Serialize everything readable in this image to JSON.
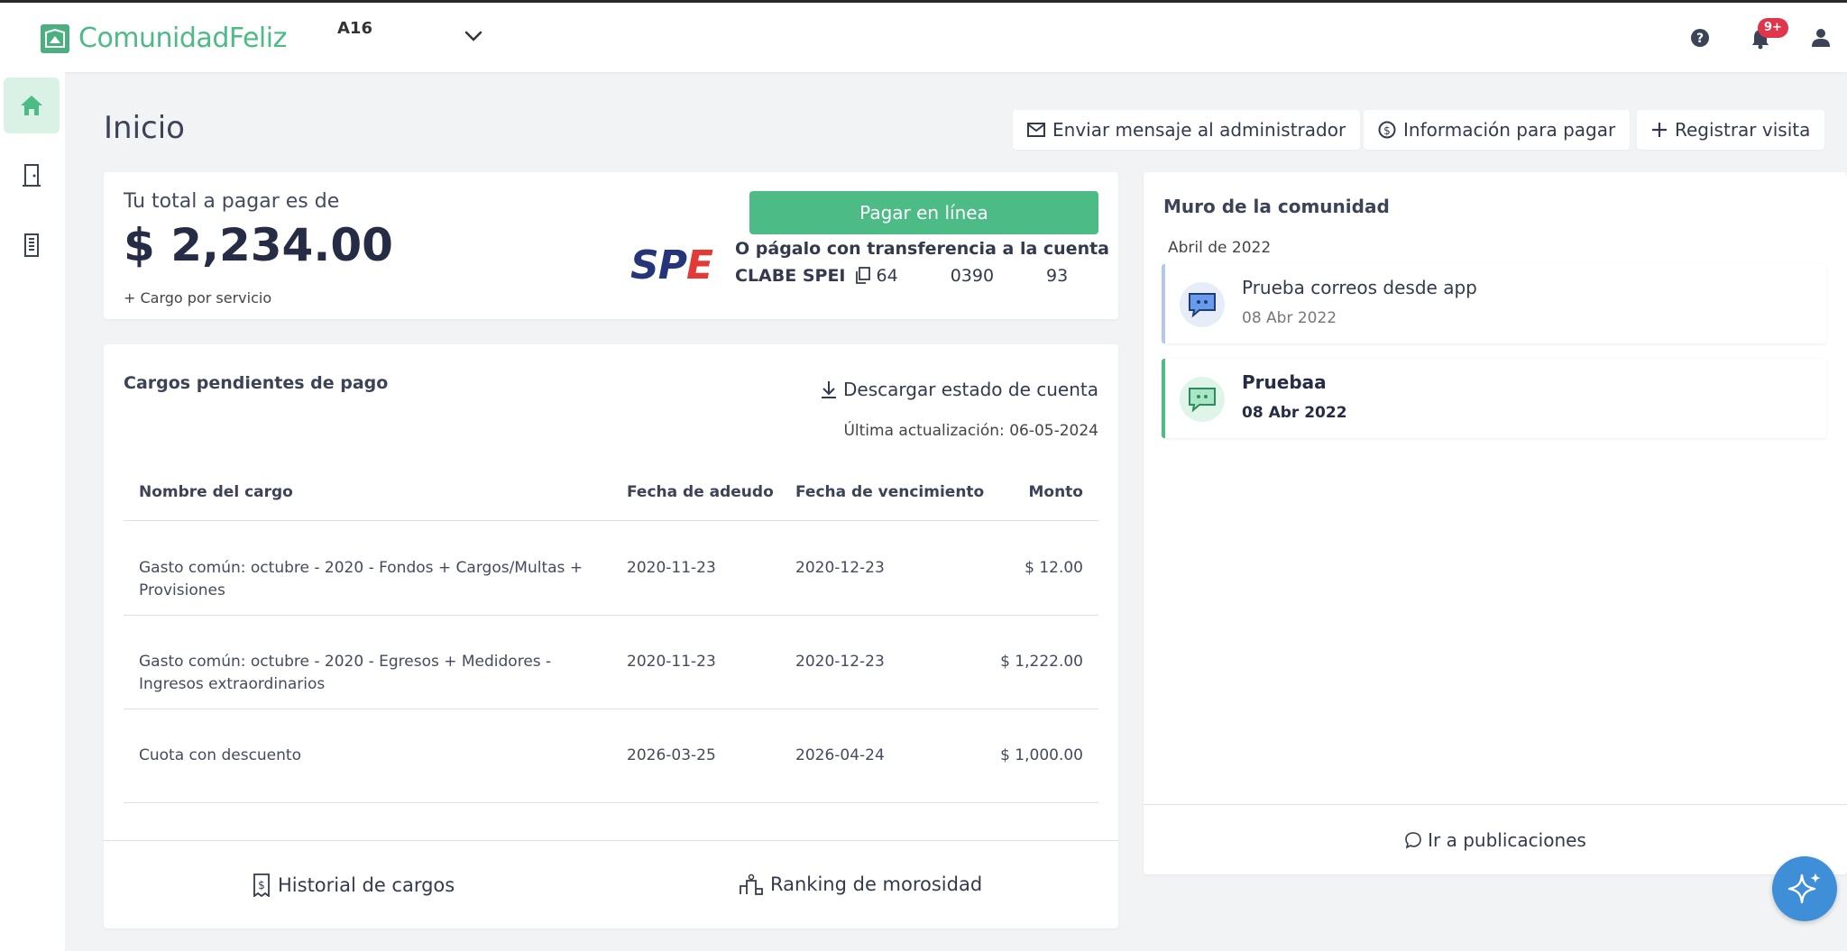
{
  "app": {
    "brand": "ComunidadFeliz",
    "unit_selector": "A16",
    "notifications_badge": "9+"
  },
  "page": {
    "title": "Inicio"
  },
  "actions": {
    "message_admin": "Enviar mensaje al administrador",
    "payment_info": "Información para pagar",
    "register_visit": "Registrar visita"
  },
  "payment": {
    "label": "Tu total a pagar es de",
    "amount": "$ 2,234.00",
    "service_charge": "+ Cargo por servicio",
    "pay_online": "Pagar en línea",
    "transfer_text": "O págalo con transferencia a la cuenta",
    "clabe_label": "CLABE SPEI",
    "clabe_parts": [
      "64",
      "0390",
      "93"
    ],
    "spei_logo": {
      "main": "SP",
      "accent": "E"
    }
  },
  "charges": {
    "title": "Cargos pendientes de pago",
    "download": "Descargar estado de cuenta",
    "last_update": "Última actualización: 06-05-2024",
    "columns": [
      "Nombre del cargo",
      "Fecha de adeudo",
      "Fecha de vencimiento",
      "Monto"
    ],
    "rows": [
      {
        "name": "Gasto común: octubre - 2020 - Fondos + Cargos/Multas + Provisiones",
        "debt_date": "2020-11-23",
        "due_date": "2020-12-23",
        "amount": "$ 12.00"
      },
      {
        "name": "Gasto común: octubre - 2020 - Egresos + Medidores - Ingresos extraordinarios",
        "debt_date": "2020-11-23",
        "due_date": "2020-12-23",
        "amount": "$ 1,222.00"
      },
      {
        "name": "Cuota con descuento",
        "debt_date": "2026-03-25",
        "due_date": "2026-04-24",
        "amount": "$ 1,000.00"
      }
    ],
    "history_link": "Historial de cargos",
    "ranking_link": "Ranking de morosidad"
  },
  "wall": {
    "title": "Muro de la comunidad",
    "month": "Abril de 2022",
    "posts": [
      {
        "title": "Prueba correos desde app",
        "date": "08 Abr 2022"
      },
      {
        "title": "Pruebaa",
        "date": "08 Abr 2022"
      }
    ],
    "go_to_posts": "Ir a publicaciones"
  },
  "colors": {
    "brand": "#4cbb86",
    "active_nav": "#d9f2e5",
    "badge": "#e0364b",
    "post_read": "#b9c7e6",
    "post_unread": "#4cbb86",
    "fab": "#3e8fd8"
  },
  "icons": [
    "home-icon",
    "door-icon",
    "building-icon",
    "help-icon",
    "bell-icon",
    "user-icon",
    "mail-icon",
    "dollar-circle-icon",
    "plus-icon",
    "download-icon",
    "copy-icon",
    "receipt-icon",
    "podium-icon",
    "chat-bubble-icon",
    "sparkle-icon",
    "chevron-down-icon"
  ]
}
